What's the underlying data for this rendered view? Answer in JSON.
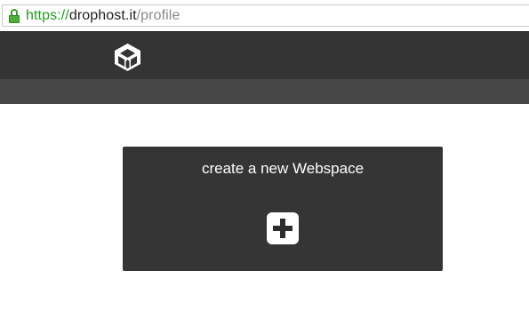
{
  "browser": {
    "url_scheme": "https://",
    "url_host": "drophost.it",
    "url_path": "/profile",
    "lock_icon": "lock-icon",
    "secure_color": "#249c22"
  },
  "header": {
    "logo_icon": "drophost-logo-icon",
    "background": "#343434",
    "subbar_background": "#474747"
  },
  "card": {
    "title": "create a new Webspace",
    "add_icon": "plus-icon",
    "background": "#353535"
  }
}
